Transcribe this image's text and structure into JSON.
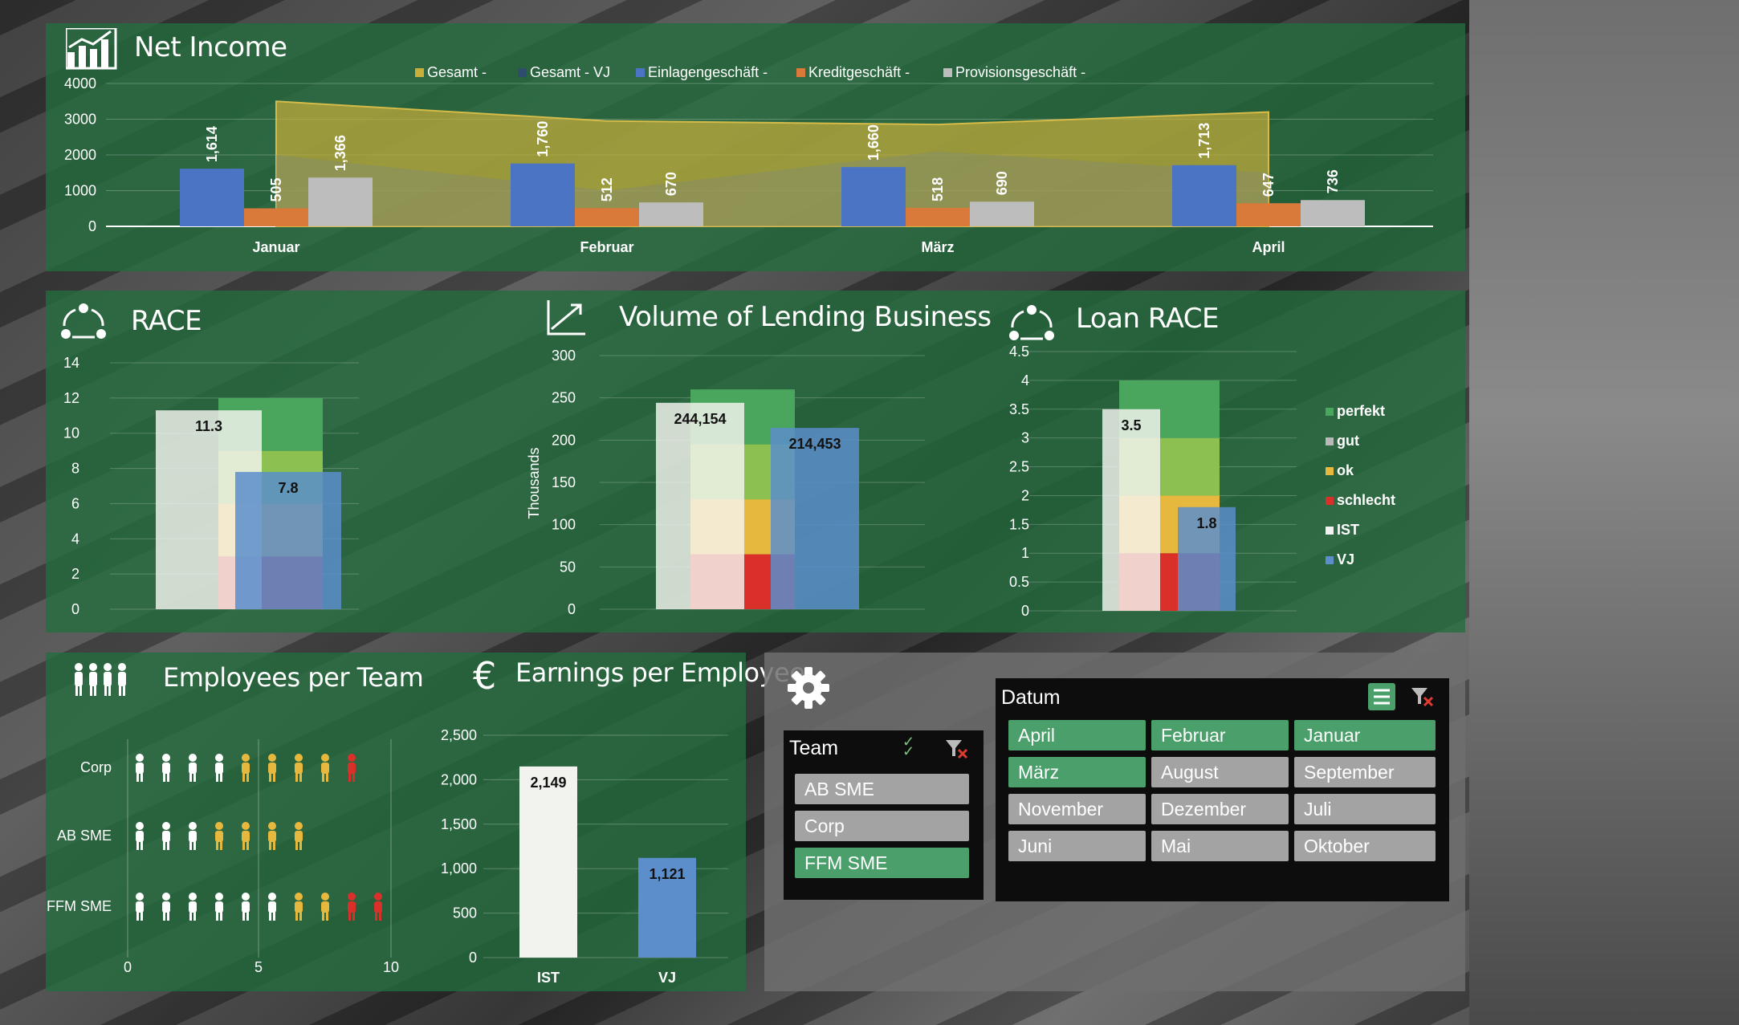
{
  "net_income": {
    "title": "Net Income",
    "legend": [
      "Gesamt -",
      "Gesamt - VJ",
      "Einlagengeschäft -",
      "Kreditgeschäft -",
      "Provisionsgeschäft -"
    ],
    "y_ticks": [
      "4000",
      "3000",
      "2000",
      "1000",
      "0"
    ],
    "months": [
      "Januar",
      "Februar",
      "März",
      "April"
    ],
    "einlagen": [
      1614,
      1760,
      1660,
      1713
    ],
    "kredit": [
      505,
      512,
      518,
      647
    ],
    "provision": [
      1366,
      670,
      690,
      736
    ],
    "einlagen_labels": [
      "1,614",
      "1,760",
      "1,660",
      "1,713"
    ],
    "kredit_labels": [
      "505",
      "512",
      "518",
      "647"
    ],
    "provision_labels": [
      "1,366",
      "670",
      "690",
      "736"
    ],
    "gesamt": [
      3500,
      2950,
      2850,
      3200
    ],
    "gesamt_vj": [
      2000,
      1000,
      2100,
      1500
    ]
  },
  "race": {
    "title": "RACE",
    "y_ticks": [
      "14",
      "12",
      "10",
      "8",
      "6",
      "4",
      "2",
      "0"
    ],
    "ist": 11.3,
    "vj": 7.8,
    "ist_label": "11.3",
    "vj_label": "7.8"
  },
  "lending": {
    "title": "Volume of Lending Business",
    "y_axis_label": "Thousands",
    "y_ticks": [
      "300",
      "250",
      "200",
      "150",
      "100",
      "50",
      "0"
    ],
    "ist_label": "244,154",
    "vj_label": "214,453"
  },
  "loan_race": {
    "title": "Loan RACE",
    "y_ticks": [
      "4.5",
      "4",
      "3.5",
      "3",
      "2.5",
      "2",
      "1.5",
      "1",
      "0.5",
      "0"
    ],
    "ist_label": "3.5",
    "vj_label": "1.8",
    "legend": [
      "perfekt",
      "gut",
      "ok",
      "schlecht",
      "IST",
      "VJ"
    ]
  },
  "employees": {
    "title": "Employees per Team",
    "teams": [
      "Corp",
      "AB SME",
      "FFM SME"
    ],
    "x_ticks": [
      "0",
      "5",
      "10"
    ],
    "counts": [
      9,
      7,
      10
    ]
  },
  "earnings": {
    "title": "Earnings per Employee",
    "y_ticks": [
      "2,500",
      "2,000",
      "1,500",
      "1,000",
      "500",
      "0"
    ],
    "categories": [
      "IST",
      "VJ"
    ],
    "labels": [
      "2,149",
      "1,121"
    ]
  },
  "slicers": {
    "team": {
      "header": "Team",
      "items": [
        "AB SME",
        "Corp",
        "FFM SME"
      ]
    },
    "datum": {
      "header": "Datum",
      "items": [
        "April",
        "Februar",
        "Januar",
        "März",
        "August",
        "September",
        "November",
        "Dezember",
        "Juli",
        "Juni",
        "Mai",
        "Oktober"
      ]
    }
  },
  "colors": {
    "green": "#4aa65d",
    "light_green": "#8cc152",
    "yellow": "#e6b93e",
    "red": "#d9302a",
    "ist": "#f0f0ec",
    "vj": "#5b8ecb",
    "einlagen": "#4c74c4",
    "kredit": "#d9793a",
    "provision": "#bdbdbd",
    "gesamt": "#c9ae3a"
  },
  "chart_data": [
    {
      "type": "bar",
      "title": "Net Income",
      "categories": [
        "Januar",
        "Februar",
        "März",
        "April"
      ],
      "series": [
        {
          "name": "Einlagengeschäft -",
          "values": [
            1614,
            1760,
            1660,
            1713
          ]
        },
        {
          "name": "Kreditgeschäft -",
          "values": [
            505,
            512,
            518,
            647
          ]
        },
        {
          "name": "Provisionsgeschäft -",
          "values": [
            1366,
            670,
            690,
            736
          ]
        },
        {
          "name": "Gesamt -",
          "values": [
            3500,
            2950,
            2850,
            3200
          ]
        },
        {
          "name": "Gesamt - VJ",
          "values": [
            2000,
            1000,
            2100,
            1500
          ]
        }
      ],
      "ylim": [
        0,
        4000
      ]
    },
    {
      "type": "bar",
      "title": "RACE",
      "categories": [
        "IST",
        "VJ"
      ],
      "values": [
        11.3,
        7.8
      ],
      "ylim": [
        0,
        14
      ]
    },
    {
      "type": "bar",
      "title": "Volume of Lending Business",
      "ylabel": "Thousands",
      "categories": [
        "IST",
        "VJ"
      ],
      "values": [
        244.154,
        214.453
      ],
      "ylim": [
        0,
        300
      ]
    },
    {
      "type": "bar",
      "title": "Loan RACE",
      "categories": [
        "IST",
        "VJ"
      ],
      "values": [
        3.5,
        1.8
      ],
      "ylim": [
        0,
        4.5
      ]
    },
    {
      "type": "bar",
      "title": "Earnings per Employee",
      "categories": [
        "IST",
        "VJ"
      ],
      "values": [
        2149,
        1121
      ],
      "ylim": [
        0,
        2500
      ]
    },
    {
      "type": "bar",
      "title": "Employees per Team",
      "categories": [
        "Corp",
        "AB SME",
        "FFM SME"
      ],
      "values": [
        9,
        7,
        10
      ],
      "xlim": [
        0,
        10
      ]
    }
  ]
}
